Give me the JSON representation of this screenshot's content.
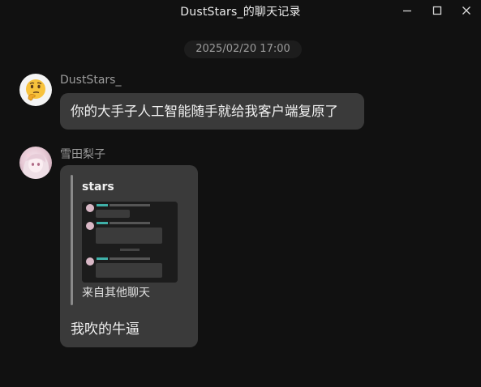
{
  "window": {
    "title": "DustStars_的聊天记录",
    "minimize_icon": "minimize-icon",
    "maximize_icon": "maximize-icon",
    "close_icon": "close-icon"
  },
  "chat": {
    "timestamp": "2025/02/20 17:00",
    "messages": [
      {
        "sender": "DustStars_",
        "avatar_icon": "thinking-face-emoji",
        "text": "你的大手子人工智能随手就给我客户端复原了"
      },
      {
        "sender": "雪田梨子",
        "avatar_icon": "anime-girl-avatar",
        "quote": {
          "author": "stars",
          "source_label": "来自其他聊天",
          "thumbnail": "chat-screenshot-thumbnail"
        },
        "text": "我吹的牛逼"
      }
    ]
  }
}
